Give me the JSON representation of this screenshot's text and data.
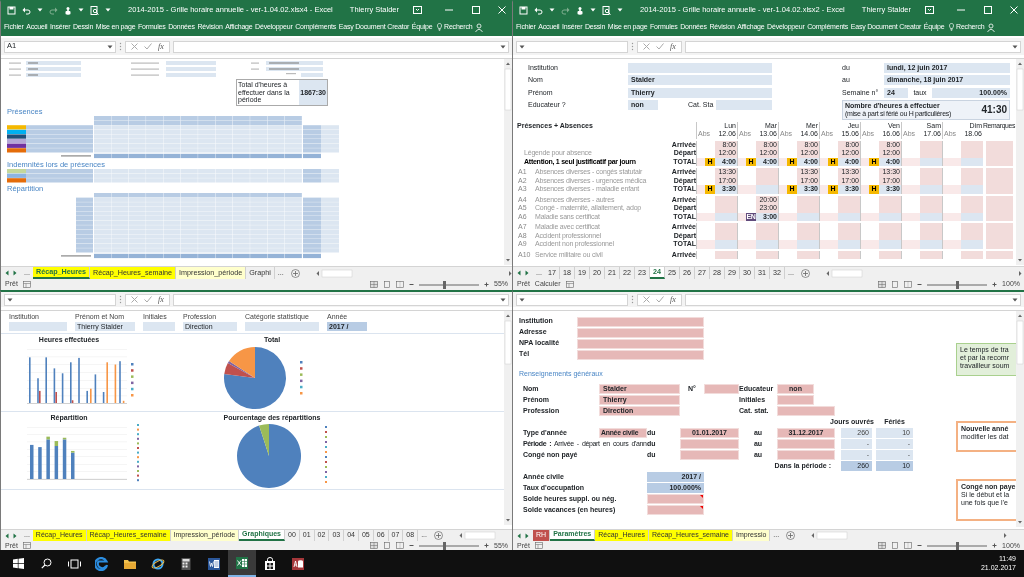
{
  "windows": [
    {
      "kind": "recap",
      "title": "2014-2015 - Grille horaire annuelle - ver-1.04.02.xlsx4 - Excel",
      "user": "Thierry Stalder",
      "ribbon_tabs": [
        "Fichier",
        "Accueil",
        "Insérer",
        "Dessin",
        "Mise en page",
        "Formules",
        "Données",
        "Révision",
        "Affichage",
        "Développeur",
        "Compléments",
        "Easy Document Creator",
        "Équipe"
      ],
      "search": "Recherch",
      "name_box": "A1",
      "fx": "fx",
      "sheet": {
        "total_box": {
          "label": "Total d'heures à effectuer dans la période",
          "value": "1867:30"
        },
        "sections": [
          {
            "title": "Présences"
          },
          {
            "title": "Indemnités lors de présences"
          },
          {
            "title": "Répartition"
          }
        ]
      },
      "sheet_tabs": [
        {
          "kind": "more",
          "label": "..."
        },
        {
          "kind": "sheet",
          "label": "Récap_Heures",
          "color": "#ffff00",
          "selected": true
        },
        {
          "kind": "sheet",
          "label": "Récap_Heures_semaine",
          "color": "#ffff00",
          "selected": false
        },
        {
          "kind": "sheet",
          "label": "Impression_période",
          "color": "#ffffcc",
          "selected": false
        },
        {
          "kind": "sheet",
          "label": "Graphi",
          "selected": false
        },
        {
          "kind": "more",
          "label": "..."
        }
      ],
      "status": [
        "Prêt"
      ],
      "zoom": {
        "text": "55%",
        "level": 0.42
      }
    },
    {
      "kind": "week",
      "title": "2014-2015 - Grille horaire annuelle - ver-1.04.02.xlsx2 - Excel",
      "user": "Thierry Stalder",
      "ribbon_tabs": [
        "Fichier",
        "Accueil",
        "Insérer",
        "Dessin",
        "Mise en page",
        "Formules",
        "Données",
        "Révision",
        "Affichage",
        "Développeur",
        "Compléments",
        "Easy Document Creator",
        "Équipe"
      ],
      "search": "Recherch",
      "fx": "fx",
      "sheet": {
        "fields": [
          {
            "label": "Institution"
          },
          {
            "label": "Nom",
            "value": "Stalder"
          },
          {
            "label": "Prénom",
            "value": "Thierry"
          },
          {
            "label": "Educateur ?",
            "value": "non",
            "extra_label": "Cat. Sta"
          }
        ],
        "dates": [
          {
            "label": "du",
            "value": "lundi, 12 juin 2017"
          },
          {
            "label": "au",
            "value": "dimanche, 18 juin 2017"
          }
        ],
        "week": {
          "label": "Semaine n°",
          "value": "24"
        },
        "rate": {
          "label": "taux",
          "value": "100.00%"
        },
        "hours_box": {
          "label": "Nombre d'heures à effectuer",
          "note": "(mise à part si férié ou H particulières)",
          "value": "41:30"
        },
        "grid": {
          "title": "Présences + Absences",
          "remarks": "Remarques",
          "days": [
            {
              "name": "Lun",
              "abs": "Abs",
              "date": "12.06"
            },
            {
              "name": "Mar",
              "abs": "Abs",
              "date": "13.06"
            },
            {
              "name": "Mer",
              "abs": "Abs",
              "date": "14.06"
            },
            {
              "name": "Jeu",
              "abs": "Abs",
              "date": "15.06"
            },
            {
              "name": "Ven",
              "abs": "Abs",
              "date": "16.06"
            },
            {
              "name": "Sam",
              "abs": "Abs",
              "date": "17.06"
            },
            {
              "name": "Dim",
              "abs": "Abs",
              "date": "18.06"
            }
          ],
          "blocks": [
            {
              "rows": [
                {
                  "type": "Arrivée"
                },
                {
                  "label": "Légende pour absence",
                  "type": "Départ"
                },
                {
                  "label": "Attention, 1 seul justificatif par journ",
                  "type": "TOTAL",
                  "bold": true
                }
              ],
              "days": [
                {
                  "kind": "time",
                  "arrival": "8:00",
                  "departure": "12:00",
                  "total": "4:00",
                  "badge": {
                    "text": "H",
                    "color": "#f5b800"
                  }
                },
                {
                  "kind": "time",
                  "arrival": "8:00",
                  "departure": "12:00",
                  "total": "4:00",
                  "badge": {
                    "text": "H",
                    "color": "#f5b800"
                  }
                },
                {
                  "kind": "time",
                  "arrival": "8:00",
                  "departure": "12:00",
                  "total": "4:00",
                  "badge": {
                    "text": "H",
                    "color": "#f5b800"
                  }
                },
                {
                  "kind": "time",
                  "arrival": "8:00",
                  "departure": "12:00",
                  "total": "4:00",
                  "badge": {
                    "text": "H",
                    "color": "#f5b800"
                  }
                },
                {
                  "kind": "time",
                  "arrival": "8:00",
                  "departure": "12:00",
                  "total": "4:00",
                  "badge": {
                    "text": "H",
                    "color": "#f5b800"
                  }
                },
                {
                  "kind": "empty"
                },
                {
                  "kind": "empty"
                }
              ]
            },
            {
              "rows": [
                {
                  "code": "A1",
                  "label": "Absences diverses - congés statutair",
                  "type": "Arrivée"
                },
                {
                  "code": "A2",
                  "label": "Absences diverses - urgences médica",
                  "type": "Départ"
                },
                {
                  "code": "A3",
                  "label": "Absences diverses - maladie enfant",
                  "type": "TOTAL"
                }
              ],
              "days": [
                {
                  "kind": "time",
                  "arrival": "13:30",
                  "departure": "17:00",
                  "total": "3:30",
                  "badge": {
                    "text": "H",
                    "color": "#f5b800"
                  }
                },
                {
                  "kind": "empty"
                },
                {
                  "kind": "time",
                  "arrival": "13:30",
                  "departure": "17:00",
                  "total": "3:30",
                  "badge": {
                    "text": "H",
                    "color": "#f5b800"
                  }
                },
                {
                  "kind": "time",
                  "arrival": "13:30",
                  "departure": "17:00",
                  "total": "3:30",
                  "badge": {
                    "text": "H",
                    "color": "#f5b800"
                  }
                },
                {
                  "kind": "time",
                  "arrival": "13:30",
                  "departure": "17:00",
                  "total": "3:30",
                  "badge": {
                    "text": "H",
                    "color": "#f5b800"
                  }
                },
                {
                  "kind": "empty"
                },
                {
                  "kind": "empty"
                }
              ]
            },
            {
              "rows": [
                {
                  "code": "A4",
                  "label": "Absences diverses - autres",
                  "type": "Arrivée"
                },
                {
                  "code": "A5",
                  "label": "Congé - maternité, allaitement, adop",
                  "type": "Départ"
                },
                {
                  "code": "A6",
                  "label": "Maladie sans certificat",
                  "type": "TOTAL"
                }
              ],
              "days": [
                {
                  "kind": "empty"
                },
                {
                  "kind": "time",
                  "arrival": "20:00",
                  "departure": "23:00",
                  "total": "3:00",
                  "badge": {
                    "text": "EN",
                    "color": "#604a7b"
                  }
                },
                {
                  "kind": "empty"
                },
                {
                  "kind": "empty"
                },
                {
                  "kind": "empty"
                },
                {
                  "kind": "empty"
                },
                {
                  "kind": "empty"
                }
              ]
            },
            {
              "rows": [
                {
                  "code": "A7",
                  "label": "Maladie avec certificat",
                  "type": "Arrivée"
                },
                {
                  "code": "A8",
                  "label": "Accident professionnel",
                  "type": "Départ"
                },
                {
                  "code": "A9",
                  "label": "Accident non professionnel",
                  "type": "TOTAL"
                }
              ]
            },
            {
              "rows": [
                {
                  "code": "A10",
                  "label": "Service militaire ou civil",
                  "type": "Arrivée"
                }
              ]
            }
          ]
        }
      },
      "sheet_tabs": [
        {
          "kind": "more",
          "label": "..."
        },
        {
          "kind": "sheet",
          "label": "17",
          "selected": false
        },
        {
          "kind": "sheet",
          "label": "18",
          "selected": false
        },
        {
          "kind": "sheet",
          "label": "19",
          "selected": false
        },
        {
          "kind": "sheet",
          "label": "20",
          "selected": false
        },
        {
          "kind": "sheet",
          "label": "21",
          "selected": false
        },
        {
          "kind": "sheet",
          "label": "22",
          "selected": false
        },
        {
          "kind": "sheet",
          "label": "23",
          "selected": false
        },
        {
          "kind": "sheet",
          "label": "24",
          "selected": true
        },
        {
          "kind": "sheet",
          "label": "25",
          "selected": false
        },
        {
          "kind": "sheet",
          "label": "26",
          "selected": false
        },
        {
          "kind": "sheet",
          "label": "27",
          "selected": false
        },
        {
          "kind": "sheet",
          "label": "28",
          "selected": false
        },
        {
          "kind": "sheet",
          "label": "29",
          "selected": false
        },
        {
          "kind": "sheet",
          "label": "30",
          "selected": false
        },
        {
          "kind": "sheet",
          "label": "31",
          "selected": false
        },
        {
          "kind": "sheet",
          "label": "32",
          "selected": false
        },
        {
          "kind": "more",
          "label": "..."
        }
      ],
      "status": [
        "Prêt",
        "Calculer"
      ],
      "zoom": {
        "text": "100%",
        "level": 0.5
      }
    },
    {
      "kind": "charts",
      "fx": "fx",
      "sheet": {
        "fields": [
          {
            "label": "Institution"
          },
          {
            "label": "Prénom et Nom",
            "value": "Thierry Stalder"
          },
          {
            "label": "Initiales"
          },
          {
            "label": "Profession",
            "value": "Direction"
          },
          {
            "label": "Catégorie statistique"
          },
          {
            "label": "Année",
            "value": "2017 /"
          }
        ],
        "charts": [
          {
            "kind": "bar",
            "title": "Heures effectuées"
          },
          {
            "kind": "pie",
            "title": "Total"
          },
          {
            "kind": "stacked",
            "title": "Répartition"
          },
          {
            "kind": "pie2",
            "title": "Pourcentage des répartitions"
          }
        ]
      },
      "sheet_tabs": [
        {
          "kind": "more",
          "label": "..."
        },
        {
          "kind": "sheet",
          "label": "Récap_Heures",
          "color": "#ffff00",
          "selected": false
        },
        {
          "kind": "sheet",
          "label": "Récap_Heures_semaine",
          "color": "#ffff00",
          "selected": false
        },
        {
          "kind": "sheet",
          "label": "Impression_période",
          "color": "#ffffcc",
          "selected": false
        },
        {
          "kind": "sheet",
          "label": "Graphiques",
          "selected": true
        },
        {
          "kind": "sheet",
          "label": "00",
          "selected": false
        },
        {
          "kind": "sheet",
          "label": "01",
          "selected": false
        },
        {
          "kind": "sheet",
          "label": "02",
          "selected": false
        },
        {
          "kind": "sheet",
          "label": "03",
          "selected": false
        },
        {
          "kind": "sheet",
          "label": "04",
          "selected": false
        },
        {
          "kind": "sheet",
          "label": "05",
          "selected": false
        },
        {
          "kind": "sheet",
          "label": "06",
          "selected": false
        },
        {
          "kind": "sheet",
          "label": "07",
          "selected": false
        },
        {
          "kind": "sheet",
          "label": "08",
          "selected": false
        },
        {
          "kind": "more",
          "label": "..."
        }
      ],
      "status": [
        "Prêt"
      ],
      "zoom": {
        "text": "55%",
        "level": 0.42
      }
    },
    {
      "kind": "params",
      "fx": "fx",
      "sheet": {
        "contact": [
          {
            "label": "Institution"
          },
          {
            "label": "Adresse"
          },
          {
            "label": "NPA localité"
          },
          {
            "label": "Tél"
          }
        ],
        "section": "Renseignements généraux",
        "identity": [
          {
            "label": "Nom",
            "value": "Stalder"
          },
          {
            "label": "Prénom",
            "value": "Thierry"
          },
          {
            "label": "Profession",
            "value": "Direction"
          }
        ],
        "extra": [
          {
            "label": "N°"
          },
          {
            "label": "Educateur",
            "value": "non"
          },
          {
            "label": "Initiales"
          },
          {
            "label": "Cat. stat."
          }
        ],
        "period_headers": [
          "Jours ouvrés",
          "Fériés"
        ],
        "periods": [
          {
            "label": "Type d'année",
            "value": "Année civile",
            "from_label": "du",
            "from": "01.01.2017",
            "to_label": "au",
            "to": "31.12.2017",
            "days": "260",
            "holidays": "10"
          },
          {
            "label": "**Période :** Arrivée - départ en cours d'ann",
            "from_label": "du",
            "to_label": "au",
            "days": "-",
            "holidays": "-"
          },
          {
            "label": "Congé non payé",
            "from_label": "du",
            "to_label": "au",
            "days": "-",
            "holidays": "-"
          }
        ],
        "in_period": {
          "label": "Dans la période :",
          "days": "260",
          "holidays": "10"
        },
        "balances": [
          {
            "label": "Année civile",
            "value": "2017 /",
            "kind": "computed"
          },
          {
            "label": "Taux d'occupation",
            "value": "100.000%",
            "kind": "computed"
          },
          {
            "label": "Solde heures suppl. ou nég.",
            "kind": "input",
            "comment": true
          },
          {
            "label": "Solde vacances (en heures)",
            "kind": "input",
            "comment": true
          }
        ],
        "notes": [
          {
            "kind": "info",
            "text": "Le temps de tra\net par la recomr\ntravailleur soum"
          },
          {
            "kind": "warning",
            "title": "Nouvelle anné",
            "text": "modifier les dat"
          },
          {
            "kind": "warning",
            "title": "Congé non paye",
            "text": "Si le début et la\nune fois que l'e"
          }
        ]
      },
      "sheet_tabs": [
        {
          "kind": "sheet",
          "label": "RH",
          "color": "#c0504d",
          "selected": false
        },
        {
          "kind": "sheet",
          "label": "Paramètres",
          "selected": true
        },
        {
          "kind": "sheet",
          "label": "Récap_Heures",
          "color": "#ffff00",
          "selected": false
        },
        {
          "kind": "sheet",
          "label": "Récap_Heures_semaine",
          "color": "#ffff00",
          "selected": false
        },
        {
          "kind": "sheet",
          "label": "Impressio",
          "color": "#ffffcc",
          "selected": false
        },
        {
          "kind": "more",
          "label": "..."
        }
      ],
      "status": [
        "Prêt"
      ],
      "zoom": {
        "text": "100%",
        "level": 0.5
      }
    }
  ],
  "taskbar": {
    "apps": [
      {
        "kind": "edge",
        "active": false
      },
      {
        "kind": "folder",
        "active": false
      },
      {
        "kind": "ie",
        "active": false
      },
      {
        "kind": "calc",
        "active": false
      },
      {
        "kind": "word",
        "active": false
      },
      {
        "kind": "excel",
        "active": true
      },
      {
        "kind": "store",
        "active": false
      },
      {
        "kind": "access",
        "active": false
      }
    ],
    "time": "11:49",
    "date": "21.02.2017"
  }
}
